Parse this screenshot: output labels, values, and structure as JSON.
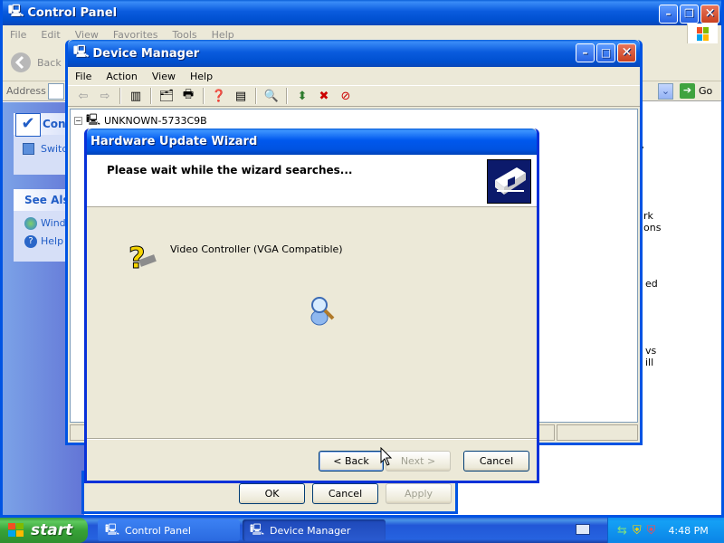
{
  "control_panel": {
    "title": "Control Panel",
    "menu": [
      "File",
      "Edit",
      "View",
      "Favorites",
      "Tools",
      "Help"
    ],
    "back_label": "Back",
    "address_label": "Address",
    "go_label": "Go",
    "task_pane": {
      "title_fragment": "Contr",
      "switch_fragment": "Switc",
      "see_also": "See Also",
      "windows_fragment": "Wind",
      "help_fragment": "Help"
    },
    "right_fragments": [
      "y",
      "rk",
      "ons",
      "ed",
      "vs",
      "ill"
    ]
  },
  "device_manager": {
    "title": "Device Manager",
    "menu": [
      "File",
      "Action",
      "View",
      "Help"
    ],
    "tree_root": "UNKNOWN-5733C9B"
  },
  "properties_dialog": {
    "ok_label": "OK",
    "cancel_label": "Cancel",
    "apply_label": "Apply"
  },
  "wizard": {
    "title": "Hardware Update Wizard",
    "heading": "Please wait while the wizard searches...",
    "device_name": "Video Controller (VGA Compatible)",
    "back_label": "< Back",
    "next_label": "Next >",
    "cancel_label": "Cancel"
  },
  "taskbar": {
    "start_label": "start",
    "tasks": [
      {
        "label": "Control Panel",
        "active": false
      },
      {
        "label": "Device Manager",
        "active": true
      }
    ],
    "clock": "4:48 PM"
  },
  "colors": {
    "desktop": "#3a6ea5",
    "title_blue": "#0054e3",
    "dialog_face": "#ece9d8",
    "link_blue": "#215dc6"
  }
}
